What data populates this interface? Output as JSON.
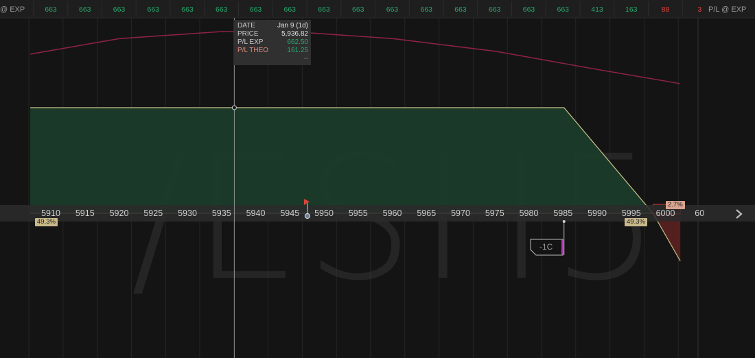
{
  "header": {
    "left_label": "@ EXP",
    "right_label": "P/L @ EXP",
    "values": [
      "663",
      "663",
      "663",
      "663",
      "663",
      "663",
      "663",
      "663",
      "663",
      "663",
      "663",
      "663",
      "663",
      "663",
      "663",
      "663",
      "413",
      "163",
      "88",
      "3"
    ],
    "value_colors": [
      "#27a86a",
      "#27a86a",
      "#27a86a",
      "#27a86a",
      "#27a86a",
      "#27a86a",
      "#27a86a",
      "#27a86a",
      "#27a86a",
      "#27a86a",
      "#27a86a",
      "#27a86a",
      "#27a86a",
      "#27a86a",
      "#27a86a",
      "#27a86a",
      "#27a86a",
      "#27a86a",
      "#e0443c",
      "#e0443c"
    ]
  },
  "watermark": "/ESH5",
  "tooltip": {
    "date_label": "DATE",
    "date_value": "Jan 9 (1d)",
    "price_label": "PRICE",
    "price_value": "5,936.82",
    "pl_exp_label": "P/L EXP",
    "pl_exp_value": "662.50",
    "pl_theo_label": "P/L THEO",
    "pl_theo_value": "161.25",
    "extra_value": "--"
  },
  "badges": {
    "left_prob": "49.3%",
    "right_prob": "49.3%",
    "tail_prob": "2.7%"
  },
  "position_label": "-1C",
  "colors": {
    "profit_fill": "#1b3d2a",
    "profit_line": "#c9c38a",
    "loss_fill": "#5a2020",
    "theo_line": "#8a2246",
    "price_axis_bg": "#2c2c2c",
    "marker": "#e0443c"
  },
  "chart_data": {
    "type": "area",
    "title": "",
    "xlabel": "",
    "ylabel": "P/L @ EXP",
    "x_ticks": [
      "5910",
      "5915",
      "5920",
      "5925",
      "5930",
      "5935",
      "5940",
      "5945",
      "5950",
      "5955",
      "5960",
      "5965",
      "5970",
      "5975",
      "5980",
      "5985",
      "5990",
      "5995",
      "6000",
      "60"
    ],
    "xlim": [
      5907,
      6002
    ],
    "series": [
      {
        "name": "P/L @ EXP",
        "x": [
          5907,
          5985,
          5998,
          6002
        ],
        "y": [
          662.5,
          662.5,
          0,
          -300
        ]
      },
      {
        "name": "P/L THEO",
        "x": [
          5907,
          5920,
          5935,
          5948,
          5960,
          5975,
          5990,
          6002
        ],
        "y": [
          450,
          560,
          610,
          600,
          560,
          470,
          340,
          240
        ]
      }
    ],
    "current_price": 5936.82,
    "underlying_last": 5947.5,
    "short_call_strike": 5985,
    "grid": true
  }
}
